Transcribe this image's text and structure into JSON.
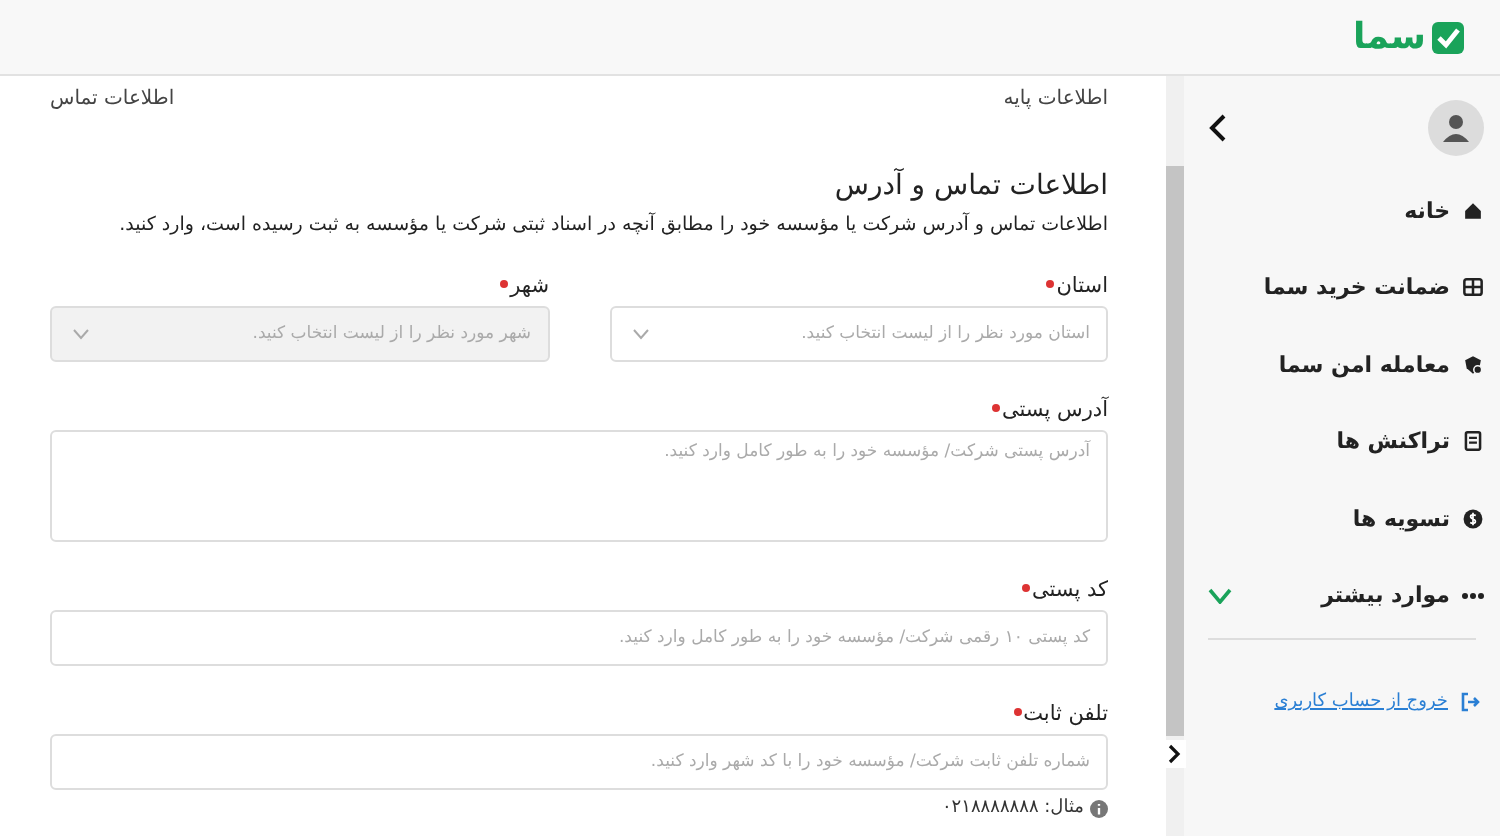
{
  "header": {
    "logo": "سما"
  },
  "sidebar": {
    "items": [
      {
        "label": "خانه"
      },
      {
        "label": "ضمانت خرید سما"
      },
      {
        "label": "معامله امن سما"
      },
      {
        "label": "تراکنش ها"
      },
      {
        "label": "تسویه ها"
      }
    ],
    "more": {
      "label": "موارد بیشتر",
      "expanded": false
    },
    "logout": "خروج از حساب کاربری"
  },
  "steps": [
    {
      "label": "اطلاعات پایه"
    },
    {
      "label": "اطلاعات تماس"
    }
  ],
  "section": {
    "title": "اطلاعات تماس و آدرس",
    "description": "اطلاعات تماس و آدرس شرکت یا مؤسسه خود را مطابق آنچه در اسناد ثبتی شرکت یا مؤسسه به ثبت رسیده است، وارد کنید."
  },
  "fields": [
    {
      "kind": "select",
      "label": "استان",
      "required": true,
      "disabled": false,
      "placeholder": "استان مورد نظر را از لیست انتخاب کنید."
    },
    {
      "kind": "select",
      "label": "شهر",
      "required": true,
      "disabled": true,
      "placeholder": "شهر مورد نظر را از لیست انتخاب کنید."
    },
    {
      "kind": "textarea",
      "label": "آدرس پستی",
      "required": true,
      "disabled": false,
      "placeholder": "آدرس پستی شرکت/ مؤسسه خود را به طور کامل وارد کنید."
    },
    {
      "kind": "text",
      "label": "کد پستی",
      "required": true,
      "disabled": false,
      "placeholder": "کد پستی ۱۰ رقمی شرکت/ مؤسسه خود را به طور کامل وارد کنید."
    },
    {
      "kind": "text",
      "label": "تلفن ثابت",
      "required": true,
      "disabled": false,
      "placeholder": "شماره تلفن ثابت شرکت/ مؤسسه خود را با کد شهر وارد کنید.",
      "hint": "مثال: ۰۲۱۸۸۸۸۸۸۸"
    }
  ]
}
